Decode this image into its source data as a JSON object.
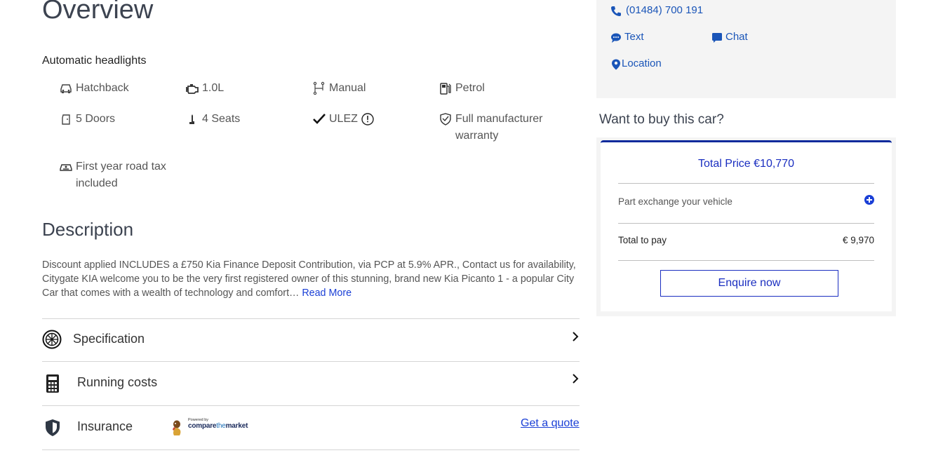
{
  "overview": {
    "title": "Overview",
    "highlight": "Automatic headlights",
    "features": [
      {
        "label": "Hatchback",
        "icon": "car-icon"
      },
      {
        "label": "1.0L",
        "icon": "engine-icon"
      },
      {
        "label": "Manual",
        "icon": "gearbox-icon"
      },
      {
        "label": "Petrol",
        "icon": "fuel-pump-icon"
      },
      {
        "label": "5 Doors",
        "icon": "door-icon"
      },
      {
        "label": "4 Seats",
        "icon": "seat-icon"
      },
      {
        "label": "ULEZ",
        "icon": "checkmark-icon"
      },
      {
        "label": "Full manufacturer warranty",
        "line1": "Full manufacturer",
        "line2": "warranty",
        "icon": "warranty-shield-icon"
      },
      {
        "label": "First year road tax included",
        "line1": "First year road tax",
        "line2": "included",
        "icon": "road-tax-icon"
      }
    ]
  },
  "description": {
    "title": "Description",
    "text": "Discount applied INCLUDES a £750 Kia Finance Deposit Contribution, via PCP at 5.9% APR., Contact us for availability, Citygate KIA welcome you to be the very first registered owner of this stunning, brand new Kia Picanto 1 - a popular City Car that comes with a wealth of technology and comfort…",
    "read_more": "Read More"
  },
  "accordion": {
    "specification": "Specification",
    "running_costs": "Running costs",
    "insurance": "Insurance",
    "get_quote": "Get a quote",
    "ctm_powered": "Powered by",
    "ctm_brand_a": "compare",
    "ctm_brand_b": "the",
    "ctm_brand_c": "market"
  },
  "contact": {
    "phone": "(01484) 700 191",
    "text": "Text",
    "chat": "Chat",
    "location": "Location"
  },
  "buy": {
    "title": "Want to buy this car?",
    "total_price": "Total Price €10,770",
    "part_exchange": "Part exchange your vehicle",
    "total_to_pay_label": "Total to pay",
    "total_to_pay_value": "€ 9,970",
    "enquire": "Enquire now"
  },
  "colors": {
    "link": "#1a3fd6",
    "accent": "#0c2a9c",
    "heading": "#3c4350"
  }
}
